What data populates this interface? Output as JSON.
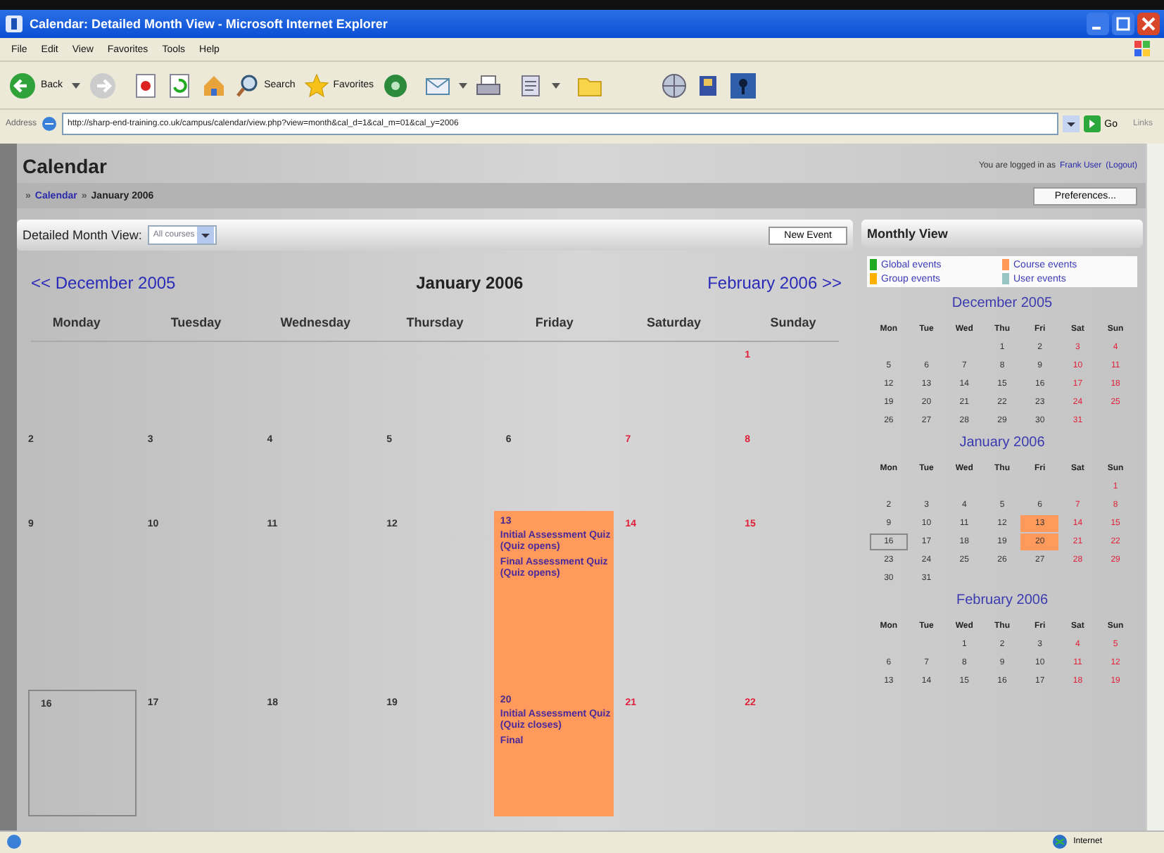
{
  "window": {
    "title": "Calendar: Detailed Month View - Microsoft Internet Explorer"
  },
  "menu": [
    "File",
    "Edit",
    "View",
    "Favorites",
    "Tools",
    "Help"
  ],
  "toolbar": {
    "back": "Back",
    "search": "Search",
    "favorites": "Favorites"
  },
  "address": {
    "label": "Address",
    "url": "http://sharp-end-training.co.uk/campus/calendar/view.php?view=month&cal_d=1&cal_m=01&cal_y=2006",
    "go": "Go",
    "links": "Links"
  },
  "page": {
    "heading": "Calendar",
    "login_text": "You are logged in as",
    "user": "Frank User",
    "logout": "(Logout)",
    "breadcrumb": [
      {
        "sep": "»",
        "label": "Calendar",
        "link": true
      },
      {
        "sep": "»",
        "label": "January 2006",
        "link": false
      }
    ],
    "preferences": "Preferences...",
    "view_label": "Detailed Month View:",
    "course_select": "All courses",
    "new_event": "New Event"
  },
  "month_nav": {
    "prev": "<< December 2005",
    "current": "January 2006",
    "next": "February 2006 >>"
  },
  "weekdays": [
    "Monday",
    "Tuesday",
    "Wednesday",
    "Thursday",
    "Friday",
    "Saturday",
    "Sunday"
  ],
  "weeks": [
    {
      "kind": "first",
      "days": [
        {
          "day": "1",
          "today": false
        }
      ]
    },
    {
      "kind": "full",
      "days": [
        {
          "day": "2",
          "today": false
        },
        {
          "day": "3",
          "today": false
        },
        {
          "day": "4",
          "today": false
        },
        {
          "day": "5",
          "today": false
        },
        {
          "day": "6",
          "today": false
        },
        {
          "day": "7",
          "today": false
        },
        {
          "day": "8",
          "today": false
        }
      ]
    },
    {
      "kind": "full",
      "days": [
        {
          "day": "9",
          "today": false
        },
        {
          "day": "10",
          "today": false
        },
        {
          "day": "11",
          "today": false
        },
        {
          "day": "12",
          "today": false
        },
        {
          "day": "13",
          "today": false,
          "events": [
            "Initial Assessment Quiz (Quiz opens)",
            "Final Assessment Quiz (Quiz opens)"
          ]
        },
        {
          "day": "14",
          "today": false
        },
        {
          "day": "15",
          "today": false
        }
      ]
    },
    {
      "kind": "full",
      "days": [
        {
          "day": "16",
          "today": true
        },
        {
          "day": "17",
          "today": false
        },
        {
          "day": "18",
          "today": false
        },
        {
          "day": "19",
          "today": false
        },
        {
          "day": "20",
          "today": false,
          "events": [
            "Initial Assessment Quiz (Quiz closes)",
            "Final"
          ]
        },
        {
          "day": "21",
          "today": false
        },
        {
          "day": "22",
          "today": false
        }
      ]
    }
  ],
  "sidebar": {
    "title": "Monthly View",
    "legend": [
      {
        "label": "Global events",
        "color": "#22aa22"
      },
      {
        "label": "Course events",
        "color": "#ff9955"
      },
      {
        "label": "Group events",
        "color": "#ffb000"
      },
      {
        "label": "User events",
        "color": "#99c4c4"
      }
    ],
    "months": [
      {
        "title": "December 2005",
        "day_headers": [
          "Mon",
          "Tue",
          "Wed",
          "Thu",
          "Fri",
          "Sat",
          "Sun"
        ],
        "weeks": [
          {
            "kind": "first",
            "days": [
              {
                "d": "1",
                "event": false,
                "today": false
              },
              {
                "d": "2",
                "event": false,
                "today": false
              },
              {
                "d": "3",
                "event": false,
                "today": false
              },
              {
                "d": "4",
                "event": false,
                "today": false
              }
            ]
          },
          {
            "kind": "full",
            "days": [
              {
                "d": "5",
                "event": false,
                "today": false
              },
              {
                "d": "6",
                "event": false,
                "today": false
              },
              {
                "d": "7",
                "event": false,
                "today": false
              },
              {
                "d": "8",
                "event": false,
                "today": false
              },
              {
                "d": "9",
                "event": false,
                "today": false
              },
              {
                "d": "10",
                "event": false,
                "today": false
              },
              {
                "d": "11",
                "event": false,
                "today": false
              }
            ]
          },
          {
            "kind": "full",
            "days": [
              {
                "d": "12",
                "event": false,
                "today": false
              },
              {
                "d": "13",
                "event": false,
                "today": false
              },
              {
                "d": "14",
                "event": false,
                "today": false
              },
              {
                "d": "15",
                "event": false,
                "today": false
              },
              {
                "d": "16",
                "event": false,
                "today": false
              },
              {
                "d": "17",
                "event": false,
                "today": false
              },
              {
                "d": "18",
                "event": false,
                "today": false
              }
            ]
          },
          {
            "kind": "full",
            "days": [
              {
                "d": "19",
                "event": false,
                "today": false
              },
              {
                "d": "20",
                "event": false,
                "today": false
              },
              {
                "d": "21",
                "event": false,
                "today": false
              },
              {
                "d": "22",
                "event": false,
                "today": false
              },
              {
                "d": "23",
                "event": false,
                "today": false
              },
              {
                "d": "24",
                "event": false,
                "today": false
              },
              {
                "d": "25",
                "event": false,
                "today": false
              }
            ]
          },
          {
            "kind": "last",
            "days": [
              {
                "d": "26",
                "event": false,
                "today": false
              },
              {
                "d": "27",
                "event": false,
                "today": false
              },
              {
                "d": "28",
                "event": false,
                "today": false
              },
              {
                "d": "29",
                "event": false,
                "today": false
              },
              {
                "d": "30",
                "event": false,
                "today": false
              },
              {
                "d": "31",
                "event": false,
                "today": false
              }
            ]
          }
        ]
      },
      {
        "title": "January 2006",
        "day_headers": [
          "Mon",
          "Tue",
          "Wed",
          "Thu",
          "Fri",
          "Sat",
          "Sun"
        ],
        "weeks": [
          {
            "kind": "first",
            "days": [
              {
                "d": "1",
                "event": false,
                "today": false
              }
            ]
          },
          {
            "kind": "full",
            "days": [
              {
                "d": "2",
                "event": false,
                "today": false
              },
              {
                "d": "3",
                "event": false,
                "today": false
              },
              {
                "d": "4",
                "event": false,
                "today": false
              },
              {
                "d": "5",
                "event": false,
                "today": false
              },
              {
                "d": "6",
                "event": false,
                "today": false
              },
              {
                "d": "7",
                "event": false,
                "today": false
              },
              {
                "d": "8",
                "event": false,
                "today": false
              }
            ]
          },
          {
            "kind": "full",
            "days": [
              {
                "d": "9",
                "event": false,
                "today": false
              },
              {
                "d": "10",
                "event": false,
                "today": false
              },
              {
                "d": "11",
                "event": false,
                "today": false
              },
              {
                "d": "12",
                "event": false,
                "today": false
              },
              {
                "d": "13",
                "event": true,
                "today": false
              },
              {
                "d": "14",
                "event": false,
                "today": false
              },
              {
                "d": "15",
                "event": false,
                "today": false
              }
            ]
          },
          {
            "kind": "full",
            "days": [
              {
                "d": "16",
                "event": false,
                "today": true
              },
              {
                "d": "17",
                "event": false,
                "today": false
              },
              {
                "d": "18",
                "event": false,
                "today": false
              },
              {
                "d": "19",
                "event": false,
                "today": false
              },
              {
                "d": "20",
                "event": true,
                "today": false
              },
              {
                "d": "21",
                "event": false,
                "today": false
              },
              {
                "d": "22",
                "event": false,
                "today": false
              }
            ]
          },
          {
            "kind": "full",
            "days": [
              {
                "d": "23",
                "event": false,
                "today": false
              },
              {
                "d": "24",
                "event": false,
                "today": false
              },
              {
                "d": "25",
                "event": false,
                "today": false
              },
              {
                "d": "26",
                "event": false,
                "today": false
              },
              {
                "d": "27",
                "event": false,
                "today": false
              },
              {
                "d": "28",
                "event": false,
                "today": false
              },
              {
                "d": "29",
                "event": false,
                "today": false
              }
            ]
          },
          {
            "kind": "last",
            "days": [
              {
                "d": "30",
                "event": false,
                "today": false
              },
              {
                "d": "31",
                "event": false,
                "today": false
              }
            ]
          }
        ]
      },
      {
        "title": "February 2006",
        "day_headers": [
          "Mon",
          "Tue",
          "Wed",
          "Thu",
          "Fri",
          "Sat",
          "Sun"
        ],
        "weeks": [
          {
            "kind": "first",
            "days": [
              {
                "d": "1",
                "event": false,
                "today": false
              },
              {
                "d": "2",
                "event": false,
                "today": false
              },
              {
                "d": "3",
                "event": false,
                "today": false
              },
              {
                "d": "4",
                "event": false,
                "today": false
              },
              {
                "d": "5",
                "event": false,
                "today": false
              }
            ]
          },
          {
            "kind": "full",
            "days": [
              {
                "d": "6",
                "event": false,
                "today": false
              },
              {
                "d": "7",
                "event": false,
                "today": false
              },
              {
                "d": "8",
                "event": false,
                "today": false
              },
              {
                "d": "9",
                "event": false,
                "today": false
              },
              {
                "d": "10",
                "event": false,
                "today": false
              },
              {
                "d": "11",
                "event": false,
                "today": false
              },
              {
                "d": "12",
                "event": false,
                "today": false
              }
            ]
          },
          {
            "kind": "full",
            "days": [
              {
                "d": "13",
                "event": false,
                "today": false
              },
              {
                "d": "14",
                "event": false,
                "today": false
              },
              {
                "d": "15",
                "event": false,
                "today": false
              },
              {
                "d": "16",
                "event": false,
                "today": false
              },
              {
                "d": "17",
                "event": false,
                "today": false
              },
              {
                "d": "18",
                "event": false,
                "today": false
              },
              {
                "d": "19",
                "event": false,
                "today": false
              }
            ]
          }
        ]
      }
    ]
  },
  "status_bar": {
    "zone": "Internet"
  }
}
